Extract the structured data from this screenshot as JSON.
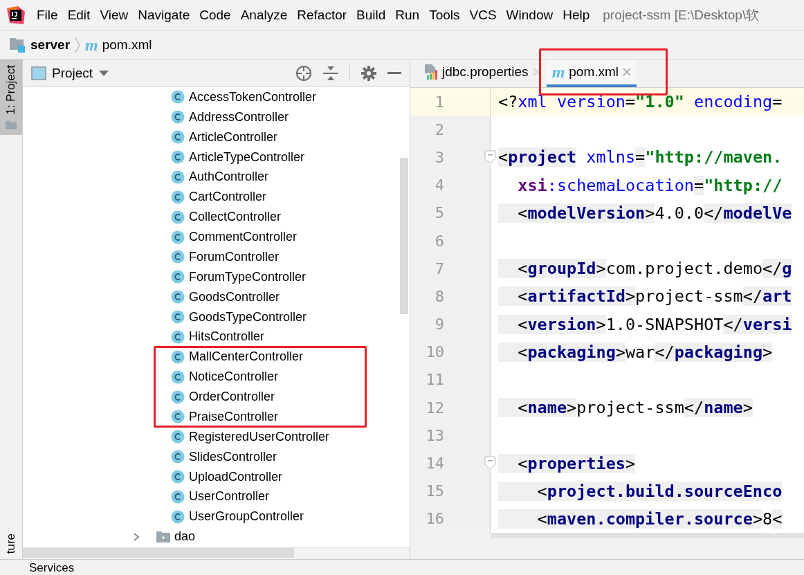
{
  "menu_bar": {
    "items": [
      "File",
      "Edit",
      "View",
      "Navigate",
      "Code",
      "Analyze",
      "Refactor",
      "Build",
      "Run",
      "Tools",
      "VCS",
      "Window",
      "Help"
    ],
    "title": "project-ssm [E:\\Desktop\\软"
  },
  "breadcrumb": {
    "module": "server",
    "file_icon": "m",
    "file": "pom.xml"
  },
  "tool_stripe": {
    "top": {
      "label": "1: Project",
      "selected": true
    },
    "bottom": {
      "label": "ture",
      "selected": false
    }
  },
  "project_panel": {
    "title": "Project",
    "tree": [
      {
        "kind": "class",
        "label": "AccessTokenController"
      },
      {
        "kind": "class",
        "label": "AddressController"
      },
      {
        "kind": "class",
        "label": "ArticleController"
      },
      {
        "kind": "class",
        "label": "ArticleTypeController"
      },
      {
        "kind": "class",
        "label": "AuthController"
      },
      {
        "kind": "class",
        "label": "CartController"
      },
      {
        "kind": "class",
        "label": "CollectController"
      },
      {
        "kind": "class",
        "label": "CommentController"
      },
      {
        "kind": "class",
        "label": "ForumController"
      },
      {
        "kind": "class",
        "label": "ForumTypeController"
      },
      {
        "kind": "class",
        "label": "GoodsController"
      },
      {
        "kind": "class",
        "label": "GoodsTypeController"
      },
      {
        "kind": "class",
        "label": "HitsController"
      },
      {
        "kind": "class",
        "label": "MallCenterController"
      },
      {
        "kind": "class",
        "label": "NoticeController"
      },
      {
        "kind": "class",
        "label": "OrderController"
      },
      {
        "kind": "class",
        "label": "PraiseController"
      },
      {
        "kind": "class",
        "label": "RegisteredUserController"
      },
      {
        "kind": "class",
        "label": "SlidesController"
      },
      {
        "kind": "class",
        "label": "UploadController"
      },
      {
        "kind": "class",
        "label": "UserController"
      },
      {
        "kind": "class",
        "label": "UserGroupController"
      },
      {
        "kind": "folder",
        "label": "dao",
        "expanded": false
      }
    ]
  },
  "editor": {
    "tabs": [
      {
        "kind": "properties",
        "label": "jdbc.properties",
        "selected": false
      },
      {
        "kind": "maven",
        "icon": "m",
        "label": "pom.xml",
        "selected": true
      }
    ],
    "lines": [
      {
        "number": "1",
        "current": true,
        "segments": [
          {
            "kind": "punct",
            "text": "<?"
          },
          {
            "kind": "attr",
            "text": "xml version"
          },
          {
            "kind": "punct",
            "text": "="
          },
          {
            "kind": "value",
            "text": "\"1.0\""
          },
          {
            "kind": "attr",
            "text": " encoding"
          },
          {
            "kind": "punct",
            "text": "="
          }
        ]
      },
      {
        "number": "2",
        "current": false
      },
      {
        "number": "3",
        "current": false,
        "fold": true,
        "segments": [
          {
            "kind": "punct",
            "text": "<"
          },
          {
            "kind": "tag",
            "text": "project"
          },
          {
            "kind": "attr",
            "text": " xmlns"
          },
          {
            "kind": "punct",
            "text": "="
          },
          {
            "kind": "value",
            "text": "\"http://maven."
          }
        ]
      },
      {
        "number": "4",
        "current": false,
        "fold": false,
        "segments": [
          {
            "kind": "ns",
            "text": "  xsi"
          },
          {
            "kind": "attr",
            "text": ":schemaLocation"
          },
          {
            "kind": "punct",
            "text": "="
          },
          {
            "kind": "value",
            "text": "\"http://"
          }
        ]
      },
      {
        "number": "5",
        "current": false,
        "segments": [
          {
            "kind": "punct",
            "text": "  <"
          },
          {
            "kind": "tag",
            "text": "modelVersion"
          },
          {
            "kind": "punct",
            "text": ">"
          },
          {
            "kind": "text",
            "text": "4.0.0"
          },
          {
            "kind": "punct",
            "text": "</"
          },
          {
            "kind": "tag",
            "text": "modelVe"
          }
        ]
      },
      {
        "number": "6",
        "current": false
      },
      {
        "number": "7",
        "current": false,
        "segments": [
          {
            "kind": "punct",
            "text": "  <"
          },
          {
            "kind": "tag",
            "text": "groupId"
          },
          {
            "kind": "punct",
            "text": ">"
          },
          {
            "kind": "text",
            "text": "com.project.demo"
          },
          {
            "kind": "punct",
            "text": "</"
          },
          {
            "kind": "tag",
            "text": "g"
          }
        ]
      },
      {
        "number": "8",
        "current": false,
        "segments": [
          {
            "kind": "punct",
            "text": "  <"
          },
          {
            "kind": "tag",
            "text": "artifactId"
          },
          {
            "kind": "punct",
            "text": ">"
          },
          {
            "kind": "text",
            "text": "project-ssm"
          },
          {
            "kind": "punct",
            "text": "</"
          },
          {
            "kind": "tag",
            "text": "art"
          }
        ]
      },
      {
        "number": "9",
        "current": false,
        "segments": [
          {
            "kind": "punct",
            "text": "  <"
          },
          {
            "kind": "tag",
            "text": "version"
          },
          {
            "kind": "punct",
            "text": ">"
          },
          {
            "kind": "text",
            "text": "1.0-SNAPSHOT"
          },
          {
            "kind": "punct",
            "text": "</"
          },
          {
            "kind": "tag",
            "text": "versi"
          }
        ]
      },
      {
        "number": "10",
        "current": false,
        "segments": [
          {
            "kind": "punct",
            "text": "  <"
          },
          {
            "kind": "tag",
            "text": "packaging"
          },
          {
            "kind": "punct",
            "text": ">"
          },
          {
            "kind": "text",
            "text": "war"
          },
          {
            "kind": "punct",
            "text": "</"
          },
          {
            "kind": "tag",
            "text": "packaging"
          },
          {
            "kind": "punct",
            "text": ">"
          }
        ]
      },
      {
        "number": "11",
        "current": false
      },
      {
        "number": "12",
        "current": false,
        "segments": [
          {
            "kind": "punct",
            "text": "  <"
          },
          {
            "kind": "tag",
            "text": "name"
          },
          {
            "kind": "punct",
            "text": ">"
          },
          {
            "kind": "text",
            "text": "project-ssm"
          },
          {
            "kind": "punct",
            "text": "</"
          },
          {
            "kind": "tag",
            "text": "name"
          },
          {
            "kind": "punct",
            "text": ">"
          }
        ]
      },
      {
        "number": "13",
        "current": false
      },
      {
        "number": "14",
        "current": false,
        "fold": true,
        "segments": [
          {
            "kind": "punct",
            "text": "  <"
          },
          {
            "kind": "tag",
            "text": "properties"
          },
          {
            "kind": "punct",
            "text": ">"
          }
        ]
      },
      {
        "number": "15",
        "current": false,
        "segments": [
          {
            "kind": "punct",
            "text": "    <"
          },
          {
            "kind": "tag",
            "text": "project.build.sourceEnco"
          }
        ]
      },
      {
        "number": "16",
        "current": false,
        "segments": [
          {
            "kind": "punct",
            "text": "    <"
          },
          {
            "kind": "tag",
            "text": "maven.compiler.source"
          },
          {
            "kind": "punct",
            "text": ">"
          },
          {
            "kind": "text",
            "text": "8"
          },
          {
            "kind": "punct",
            "text": "<"
          }
        ]
      }
    ]
  },
  "bottom_bar": {
    "tab": "Services"
  }
}
